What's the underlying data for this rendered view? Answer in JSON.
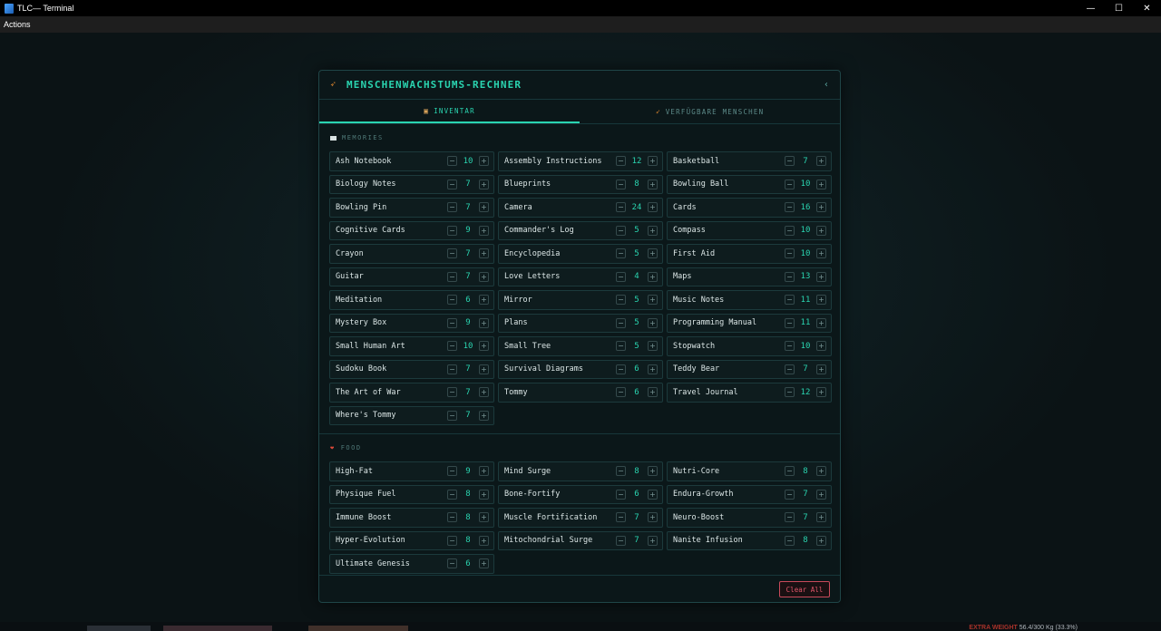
{
  "window": {
    "title": "TLC— Terminal",
    "controls": {
      "minimize": "—",
      "maximize": "☐",
      "close": "✕"
    }
  },
  "menubar": {
    "actions": "Actions"
  },
  "panel": {
    "title": "MENSCHENWACHSTUMS-RECHNER",
    "collapse": "‹",
    "tabs": [
      {
        "label": "INVENTAR",
        "icon": "▣",
        "active": true
      },
      {
        "label": "VERFÜGBARE MENSCHEN",
        "icon": "➶",
        "active": false
      }
    ],
    "sections": [
      {
        "title": "MEMORIES",
        "icon": "memory-card-icon",
        "items": [
          {
            "name": "Ash Notebook",
            "qty": "10"
          },
          {
            "name": "Assembly Instructions",
            "qty": "12"
          },
          {
            "name": "Basketball",
            "qty": "7"
          },
          {
            "name": "Biology Notes",
            "qty": "7"
          },
          {
            "name": "Blueprints",
            "qty": "8"
          },
          {
            "name": "Bowling Ball",
            "qty": "10"
          },
          {
            "name": "Bowling Pin",
            "qty": "7"
          },
          {
            "name": "Camera",
            "qty": "24"
          },
          {
            "name": "Cards",
            "qty": "16"
          },
          {
            "name": "Cognitive Cards",
            "qty": "9"
          },
          {
            "name": "Commander's Log",
            "qty": "5"
          },
          {
            "name": "Compass",
            "qty": "10"
          },
          {
            "name": "Crayon",
            "qty": "7"
          },
          {
            "name": "Encyclopedia",
            "qty": "5"
          },
          {
            "name": "First Aid",
            "qty": "10"
          },
          {
            "name": "Guitar",
            "qty": "7"
          },
          {
            "name": "Love Letters",
            "qty": "4"
          },
          {
            "name": "Maps",
            "qty": "13"
          },
          {
            "name": "Meditation",
            "qty": "6"
          },
          {
            "name": "Mirror",
            "qty": "5"
          },
          {
            "name": "Music Notes",
            "qty": "11"
          },
          {
            "name": "Mystery Box",
            "qty": "9"
          },
          {
            "name": "Plans",
            "qty": "5"
          },
          {
            "name": "Programming Manual",
            "qty": "11"
          },
          {
            "name": "Small Human Art",
            "qty": "10"
          },
          {
            "name": "Small Tree",
            "qty": "5"
          },
          {
            "name": "Stopwatch",
            "qty": "10"
          },
          {
            "name": "Sudoku Book",
            "qty": "7"
          },
          {
            "name": "Survival Diagrams",
            "qty": "6"
          },
          {
            "name": "Teddy Bear",
            "qty": "7"
          },
          {
            "name": "The Art of War",
            "qty": "7"
          },
          {
            "name": "Tommy",
            "qty": "6"
          },
          {
            "name": "Travel Journal",
            "qty": "12"
          },
          {
            "name": "Where's Tommy",
            "qty": "7"
          }
        ]
      },
      {
        "title": "FOOD",
        "icon": "food-icon",
        "items": [
          {
            "name": "High-Fat",
            "qty": "9"
          },
          {
            "name": "Mind Surge",
            "qty": "8"
          },
          {
            "name": "Nutri-Core",
            "qty": "8"
          },
          {
            "name": "Physique Fuel",
            "qty": "8"
          },
          {
            "name": "Bone-Fortify",
            "qty": "6"
          },
          {
            "name": "Endura-Growth",
            "qty": "7"
          },
          {
            "name": "Immune Boost",
            "qty": "8"
          },
          {
            "name": "Muscle Fortification",
            "qty": "7"
          },
          {
            "name": "Neuro-Boost",
            "qty": "7"
          },
          {
            "name": "Hyper-Evolution",
            "qty": "8"
          },
          {
            "name": "Mitochondrial Surge",
            "qty": "7"
          },
          {
            "name": "Nanite Infusion",
            "qty": "8"
          },
          {
            "name": "Ultimate Genesis",
            "qty": "6"
          }
        ]
      }
    ],
    "stepper": {
      "minus": "−",
      "plus": "+"
    },
    "clear_all": "Clear All"
  },
  "status": {
    "weight_label": "EXTRA WEIGHT",
    "weight_value": "56.4/300 Kg (33.3%)"
  },
  "colors": {
    "accent": "#2ad4b0",
    "danger": "#e0566a",
    "panel_bg": "#0b1719"
  }
}
